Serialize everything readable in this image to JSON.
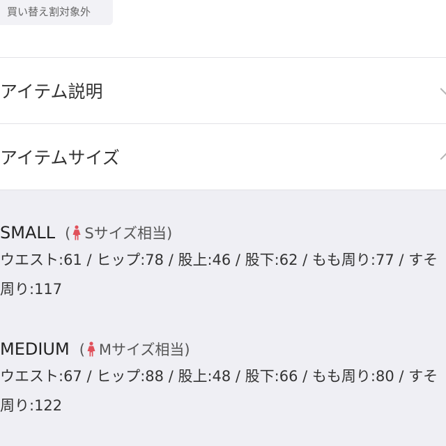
{
  "tag": {
    "label": "買い替え割対象外"
  },
  "accordions": {
    "description": {
      "title": "アイテム説明",
      "state": "collapsed"
    },
    "size": {
      "title": "アイテムサイズ",
      "state": "expanded"
    }
  },
  "sizes": [
    {
      "name": "SMALL",
      "note_open": "(",
      "note_text": "Sサイズ相当)",
      "line1": "ウエスト:61 / ヒップ:78 / 股上:46 / 股下:62 / もも周り:77 / すそ",
      "line2": "周り:117"
    },
    {
      "name": "MEDIUM",
      "note_open": "(",
      "note_text": "Mサイズ相当)",
      "line1": "ウエスト:67 / ヒップ:88 / 股上:48 / 股下:66 / もも周り:80 / すそ",
      "line2": "周り:122"
    }
  ],
  "colors": {
    "woman_icon": "#e0505a",
    "panel_bg": "#efeff4",
    "divider": "#e2e2e6"
  },
  "icons": {
    "woman": "woman-icon",
    "chevron_down": "chevron-down-icon",
    "chevron_up": "chevron-up-icon"
  }
}
